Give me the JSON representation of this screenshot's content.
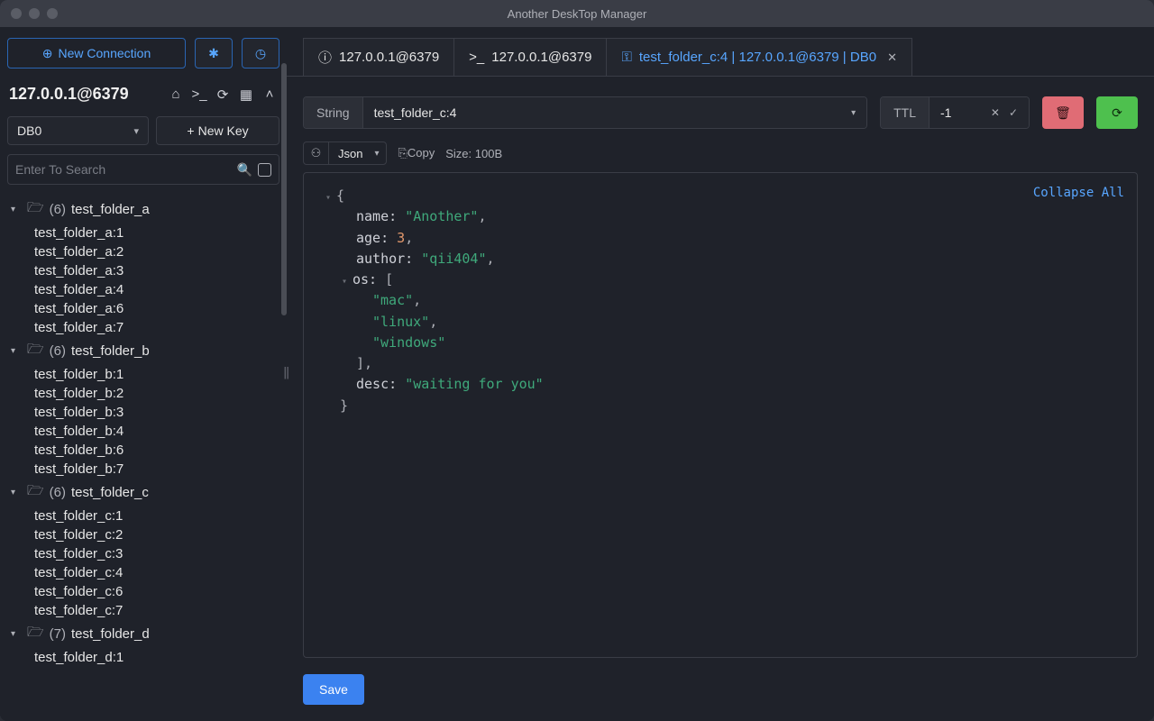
{
  "window": {
    "title": "Another DeskTop Manager"
  },
  "sidebar": {
    "new_connection": "New Connection",
    "connection_title": "127.0.0.1@6379",
    "db_selected": "DB0",
    "new_key": "New Key",
    "search_placeholder": "Enter To Search"
  },
  "tree": [
    {
      "count": 6,
      "name": "test_folder_a",
      "items": [
        "test_folder_a:1",
        "test_folder_a:2",
        "test_folder_a:3",
        "test_folder_a:4",
        "test_folder_a:6",
        "test_folder_a:7"
      ]
    },
    {
      "count": 6,
      "name": "test_folder_b",
      "items": [
        "test_folder_b:1",
        "test_folder_b:2",
        "test_folder_b:3",
        "test_folder_b:4",
        "test_folder_b:6",
        "test_folder_b:7"
      ]
    },
    {
      "count": 6,
      "name": "test_folder_c",
      "items": [
        "test_folder_c:1",
        "test_folder_c:2",
        "test_folder_c:3",
        "test_folder_c:4",
        "test_folder_c:6",
        "test_folder_c:7"
      ]
    },
    {
      "count": 7,
      "name": "test_folder_d",
      "items": [
        "test_folder_d:1"
      ]
    }
  ],
  "tabs": [
    {
      "icon": "info",
      "label": "127.0.0.1@6379",
      "active": false
    },
    {
      "icon": "terminal",
      "label": "127.0.0.1@6379",
      "active": false
    },
    {
      "icon": "key",
      "label": "test_folder_c:4 | 127.0.0.1@6379 | DB0",
      "active": true,
      "closable": true
    }
  ],
  "key": {
    "type": "String",
    "name": "test_folder_c:4",
    "ttl_label": "TTL",
    "ttl_value": "-1"
  },
  "format": {
    "view": "Json",
    "copy": "Copy",
    "size_label": "Size:",
    "size_value": "100B"
  },
  "viewer": {
    "collapse_all": "Collapse All",
    "json": {
      "name": "Another",
      "age": 3,
      "author": "qii404",
      "os": [
        "mac",
        "linux",
        "windows"
      ],
      "desc": "waiting for you"
    }
  },
  "save": "Save"
}
